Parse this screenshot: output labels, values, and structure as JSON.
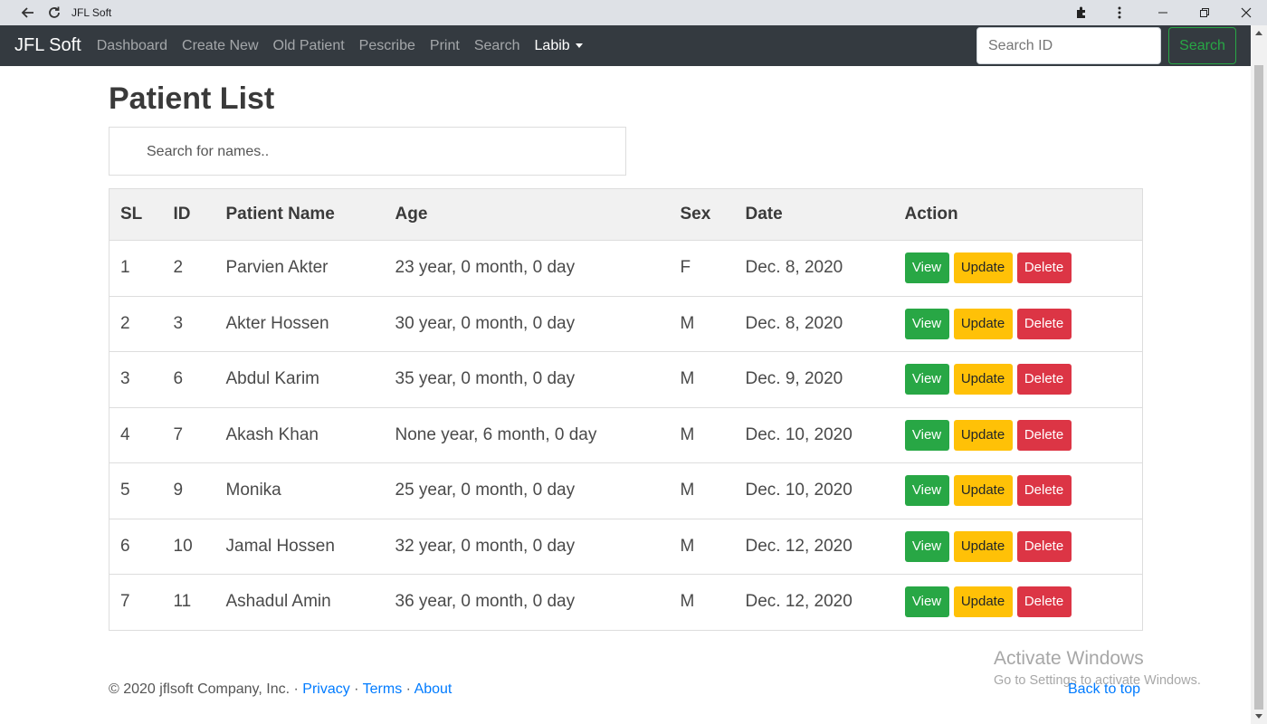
{
  "browser": {
    "tab_title": "JFL Soft",
    "icons": [
      "back-arrow-icon",
      "reload-icon",
      "extensions-icon",
      "kebab-menu-icon",
      "minimize-icon",
      "restore-icon",
      "close-icon"
    ]
  },
  "navbar": {
    "brand": "JFL Soft",
    "links": [
      "Dashboard",
      "Create New",
      "Old Patient",
      "Pescribe",
      "Print",
      "Search"
    ],
    "user_menu": "Labib",
    "search_placeholder": "Search ID",
    "search_button": "Search"
  },
  "main": {
    "title": "Patient List",
    "name_search_placeholder": "Search for names..",
    "table": {
      "headers": [
        "SL",
        "ID",
        "Patient Name",
        "Age",
        "Sex",
        "Date",
        "Action"
      ],
      "rows": [
        {
          "sl": "1",
          "id": "2",
          "name": "Parvien Akter",
          "age": "23 year, 0 month, 0 day",
          "sex": "F",
          "date": "Dec. 8, 2020"
        },
        {
          "sl": "2",
          "id": "3",
          "name": "Akter Hossen",
          "age": "30 year, 0 month, 0 day",
          "sex": "M",
          "date": "Dec. 8, 2020"
        },
        {
          "sl": "3",
          "id": "6",
          "name": "Abdul Karim",
          "age": "35 year, 0 month, 0 day",
          "sex": "M",
          "date": "Dec. 9, 2020"
        },
        {
          "sl": "4",
          "id": "7",
          "name": "Akash Khan",
          "age": "None year, 6 month, 0 day",
          "sex": "M",
          "date": "Dec. 10, 2020"
        },
        {
          "sl": "5",
          "id": "9",
          "name": "Monika",
          "age": "25 year, 0 month, 0 day",
          "sex": "M",
          "date": "Dec. 10, 2020"
        },
        {
          "sl": "6",
          "id": "10",
          "name": "Jamal Hossen",
          "age": "32 year, 0 month, 0 day",
          "sex": "M",
          "date": "Dec. 12, 2020"
        },
        {
          "sl": "7",
          "id": "11",
          "name": "Ashadul Amin",
          "age": "36 year, 0 month, 0 day",
          "sex": "M",
          "date": "Dec. 12, 2020"
        }
      ],
      "actions": {
        "view": "View",
        "update": "Update",
        "delete": "Delete"
      }
    }
  },
  "footer": {
    "copyright": "© 2020 jflsoft Company, Inc. ·",
    "privacy": "Privacy",
    "terms": "Terms",
    "about": "About",
    "sep": "·",
    "back_to_top": "Back to top"
  },
  "watermark": {
    "line1": "Activate Windows",
    "line2": "Go to Settings to activate Windows."
  },
  "colors": {
    "navbar_bg": "#343a40",
    "success": "#28a745",
    "warning": "#ffc107",
    "danger": "#dc3545",
    "link": "#007bff"
  }
}
